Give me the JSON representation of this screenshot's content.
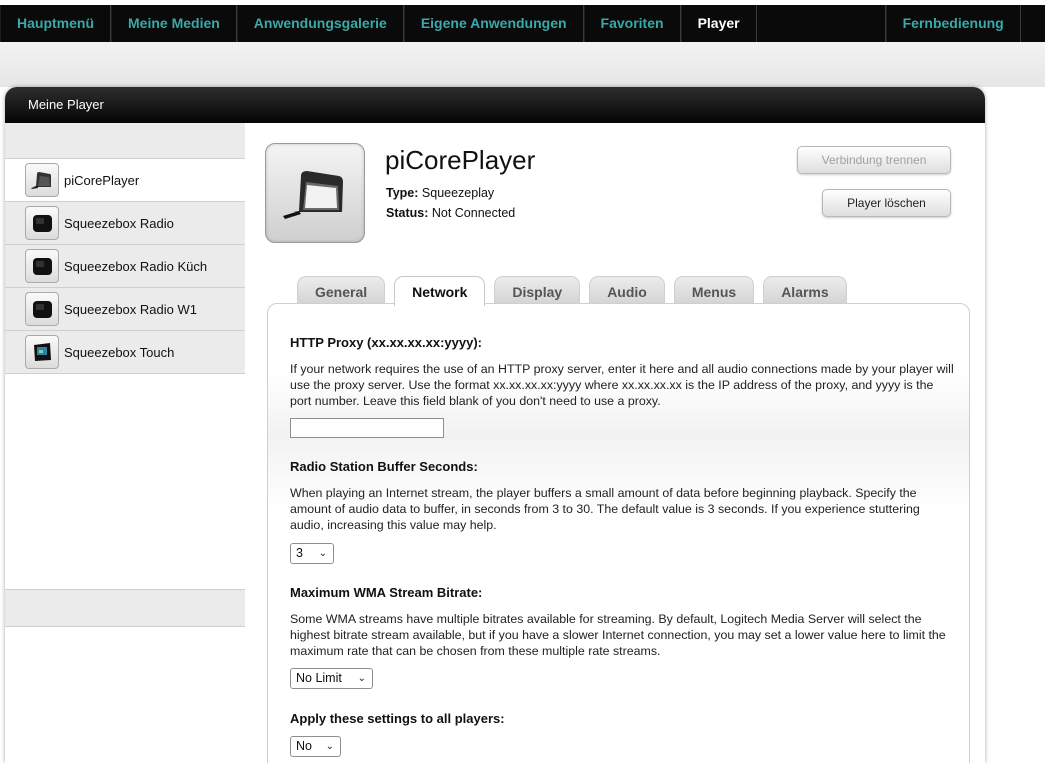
{
  "nav": {
    "items": [
      "Hauptmenü",
      "Meine Medien",
      "Anwendungsgalerie",
      "Eigene Anwendungen",
      "Favoriten",
      "Player"
    ],
    "remote": "Fernbedienung"
  },
  "panel": {
    "title": "Meine Player"
  },
  "sidebar": {
    "items": [
      {
        "label": "piCorePlayer",
        "icon": "picoreplayer-icon"
      },
      {
        "label": "Squeezebox Radio",
        "icon": "squeezebox-radio-icon"
      },
      {
        "label": "Squeezebox Radio Küch",
        "icon": "squeezebox-radio-icon"
      },
      {
        "label": "Squeezebox Radio W1",
        "icon": "squeezebox-radio-icon"
      },
      {
        "label": "Squeezebox Touch",
        "icon": "squeezebox-touch-icon"
      }
    ]
  },
  "player": {
    "name": "piCorePlayer",
    "type_label": "Type:",
    "type_value": "Squeezeplay",
    "status_label": "Status:",
    "status_value": "Not Connected",
    "disconnect_label": "Verbindung trennen",
    "delete_label": "Player löschen"
  },
  "tabs": [
    "General",
    "Network",
    "Display",
    "Audio",
    "Menus",
    "Alarms"
  ],
  "network": {
    "proxy_title": "HTTP Proxy (xx.xx.xx.xx:yyyy):",
    "proxy_text": "If your network requires the use of an HTTP proxy server, enter it here and all audio connections made by your player will use the proxy server. Use the format xx.xx.xx.xx:yyyy where xx.xx.xx.xx is the IP address of the proxy, and yyyy is the port number. Leave this field blank of you don't need to use a proxy.",
    "proxy_value": "",
    "buffer_title": "Radio Station Buffer Seconds:",
    "buffer_text": "When playing an Internet stream, the player buffers a small amount of data before beginning playback. Specify the amount of audio data to buffer, in seconds from 3 to 30. The default value is 3 seconds. If you experience stuttering audio, increasing this value may help.",
    "buffer_value": "3",
    "wma_title": "Maximum WMA Stream Bitrate:",
    "wma_text": "Some WMA streams have multiple bitrates available for streaming. By default, Logitech Media Server will select the highest bitrate stream available, but if you have a slower Internet connection, you may set a lower value here to limit the maximum rate that can be chosen from these multiple rate streams.",
    "wma_value": "No Limit",
    "apply_title": "Apply these settings to all players:",
    "apply_value": "No"
  },
  "colors": {
    "nav_text": "#39a9a9",
    "nav_active": "#ffffff",
    "nav_bg": "#0a0a0a"
  }
}
